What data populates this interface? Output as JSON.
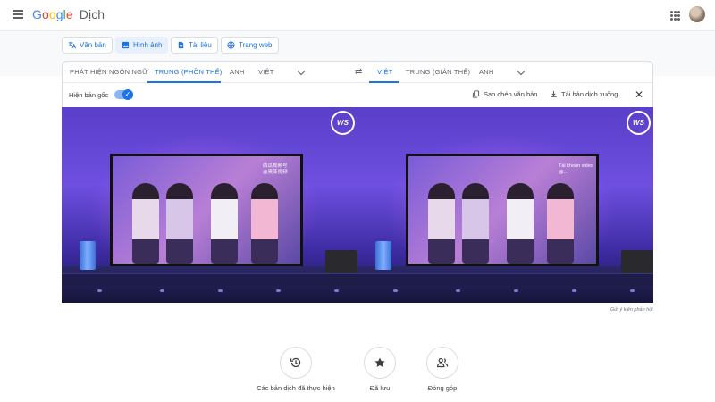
{
  "app": {
    "logo_google": "Google",
    "logo_product": "Dịch"
  },
  "modes": [
    {
      "label": "Văn bản",
      "icon": "text-translate-icon",
      "active": false
    },
    {
      "label": "Hình ảnh",
      "icon": "image-icon",
      "active": true
    },
    {
      "label": "Tài liệu",
      "icon": "document-icon",
      "active": false
    },
    {
      "label": "Trang web",
      "icon": "globe-icon",
      "active": false
    }
  ],
  "source_langs": [
    "PHÁT HIỆN NGÔN NGỮ",
    "TRUNG (PHỒN THỂ)",
    "ANH",
    "VIỆT"
  ],
  "source_selected": "TRUNG (PHỒN THỂ)",
  "target_langs": [
    "VIỆT",
    "TRUNG (GIẢN THỂ)",
    "ANH"
  ],
  "target_selected": "VIỆT",
  "options": {
    "show_original_label": "Hiện bản gốc",
    "show_original_on": true,
    "copy_text_label": "Sao chép văn bản",
    "download_label": "Tải bản dịch xuống"
  },
  "images": {
    "badge_text": "WS",
    "left_watermark": "西瓜视频号\n@奥菲视频",
    "right_watermark": "Tài khoản video\n@..."
  },
  "feedback_label": "Gửi ý kiến phản hồi",
  "bottom": [
    {
      "label": "Các bản dịch đã thực hiện",
      "icon": "history-icon"
    },
    {
      "label": "Đã lưu",
      "icon": "star-icon"
    },
    {
      "label": "Đóng góp",
      "icon": "people-icon"
    }
  ],
  "colors": {
    "accent": "#1a73e8",
    "active_mode_bg": "#e8f0fe"
  }
}
